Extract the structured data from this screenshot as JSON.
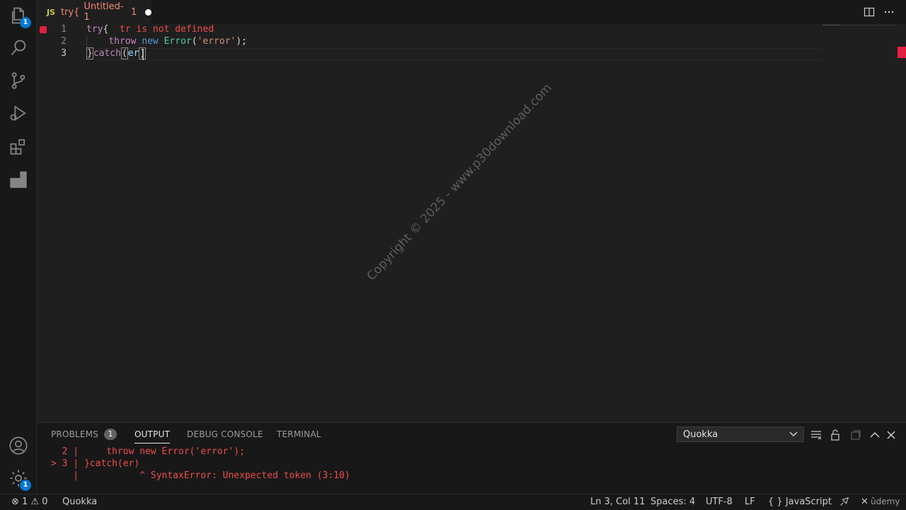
{
  "activity_bar": {
    "explorer_badge": "1",
    "settings_badge": "1"
  },
  "tab": {
    "lang": "JS",
    "symbol": "try{",
    "filename": "Untitled-1",
    "problem_count": "1"
  },
  "editor": {
    "line_numbers": [
      "1",
      "2",
      "3"
    ],
    "error_inline": "tr is not defined",
    "line1_kw": "try",
    "line1_brace": "{",
    "line2_throw": "throw",
    "line2_new": "new",
    "line2_class": "Error",
    "line2_open": "(",
    "line2_str": "'error'",
    "line2_close": ");",
    "line3_brace": "}",
    "line3_kw": "catch",
    "line3_open": "(",
    "line3_var": "er",
    "line3_close": ")"
  },
  "watermark": "Copyright © 2025 - www.p30download.com",
  "panel": {
    "tabs": [
      "PROBLEMS",
      "OUTPUT",
      "DEBUG CONSOLE",
      "TERMINAL"
    ],
    "problems_count": "1",
    "output_channel": "Quokka",
    "output_lines": [
      "  2 |     throw new Error('error');",
      "> 3 | }catch(er)",
      "    |           ^ SyntaxError: Unexpected token (3:10)"
    ]
  },
  "status_bar": {
    "errors": "1",
    "warnings": "0",
    "quokka": "Quokka",
    "position": "Ln 3, Col 11",
    "spaces": "Spaces: 4",
    "encoding": "UTF-8",
    "eol": "LF",
    "language": "JavaScript",
    "brand": "ûdemy"
  },
  "colors": {
    "error": "#f14c4c",
    "accent": "#0078d4",
    "background": "#1f1f1f"
  }
}
